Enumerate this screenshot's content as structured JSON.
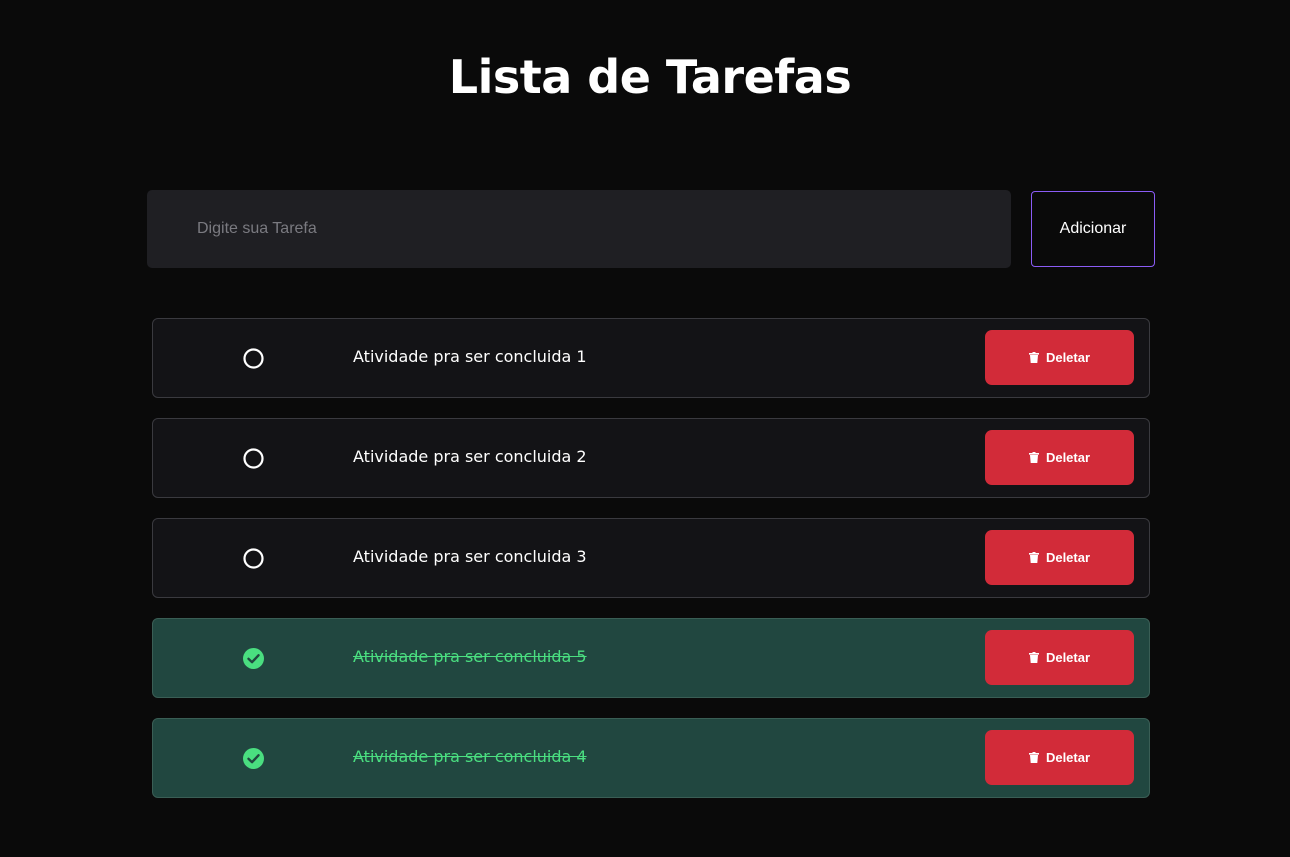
{
  "header": {
    "title": "Lista de Tarefas"
  },
  "form": {
    "placeholder": "Digite sua Tarefa",
    "value": "",
    "add_label": "Adicionar"
  },
  "tasks": [
    {
      "text": "Atividade pra ser concluida 1",
      "done": false,
      "delete_label": "Deletar"
    },
    {
      "text": "Atividade pra ser concluida 2",
      "done": false,
      "delete_label": "Deletar"
    },
    {
      "text": "Atividade pra ser concluida 3",
      "done": false,
      "delete_label": "Deletar"
    },
    {
      "text": "Atividade pra ser concluida 5",
      "done": true,
      "delete_label": "Deletar"
    },
    {
      "text": "Atividade pra ser concluida 4",
      "done": true,
      "delete_label": "Deletar"
    }
  ],
  "icons": {
    "pending": "circle-outline-icon",
    "done": "check-circle-icon",
    "delete": "trash-icon"
  },
  "colors": {
    "accent": "#8b5cf6",
    "delete": "#d22b39",
    "done_bg": "#214740",
    "done_text": "#4ade80"
  }
}
